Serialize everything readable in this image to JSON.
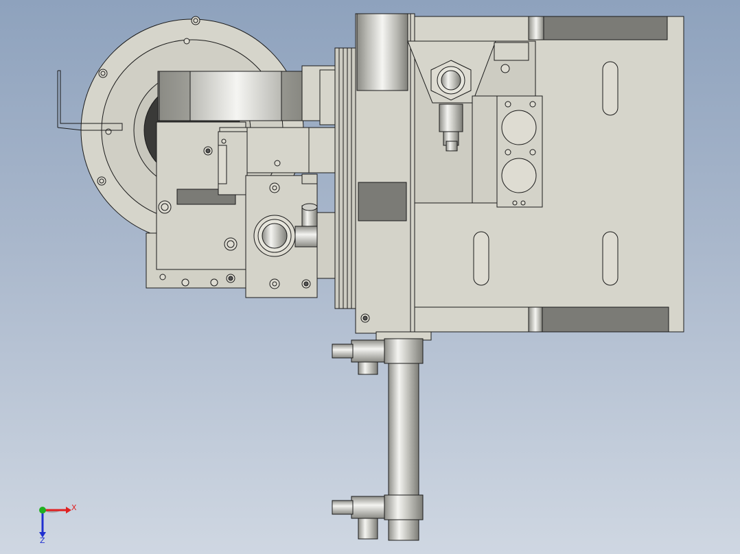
{
  "colors": {
    "part_fill": "#d2d1c6",
    "part_fill_light": "#dedcd2",
    "part_dark": "#7b7b76",
    "edge": "#1a1a1a",
    "metal_light": "#f2f2ef",
    "metal_dark": "#9a9a94",
    "background_top": "#8ea2bd",
    "background_bottom": "#cfd7e2",
    "axis_x": "#e02020",
    "axis_y": "#20b020",
    "axis_z": "#2030d0"
  },
  "triad": {
    "x_label": "X",
    "z_label": "Z"
  }
}
